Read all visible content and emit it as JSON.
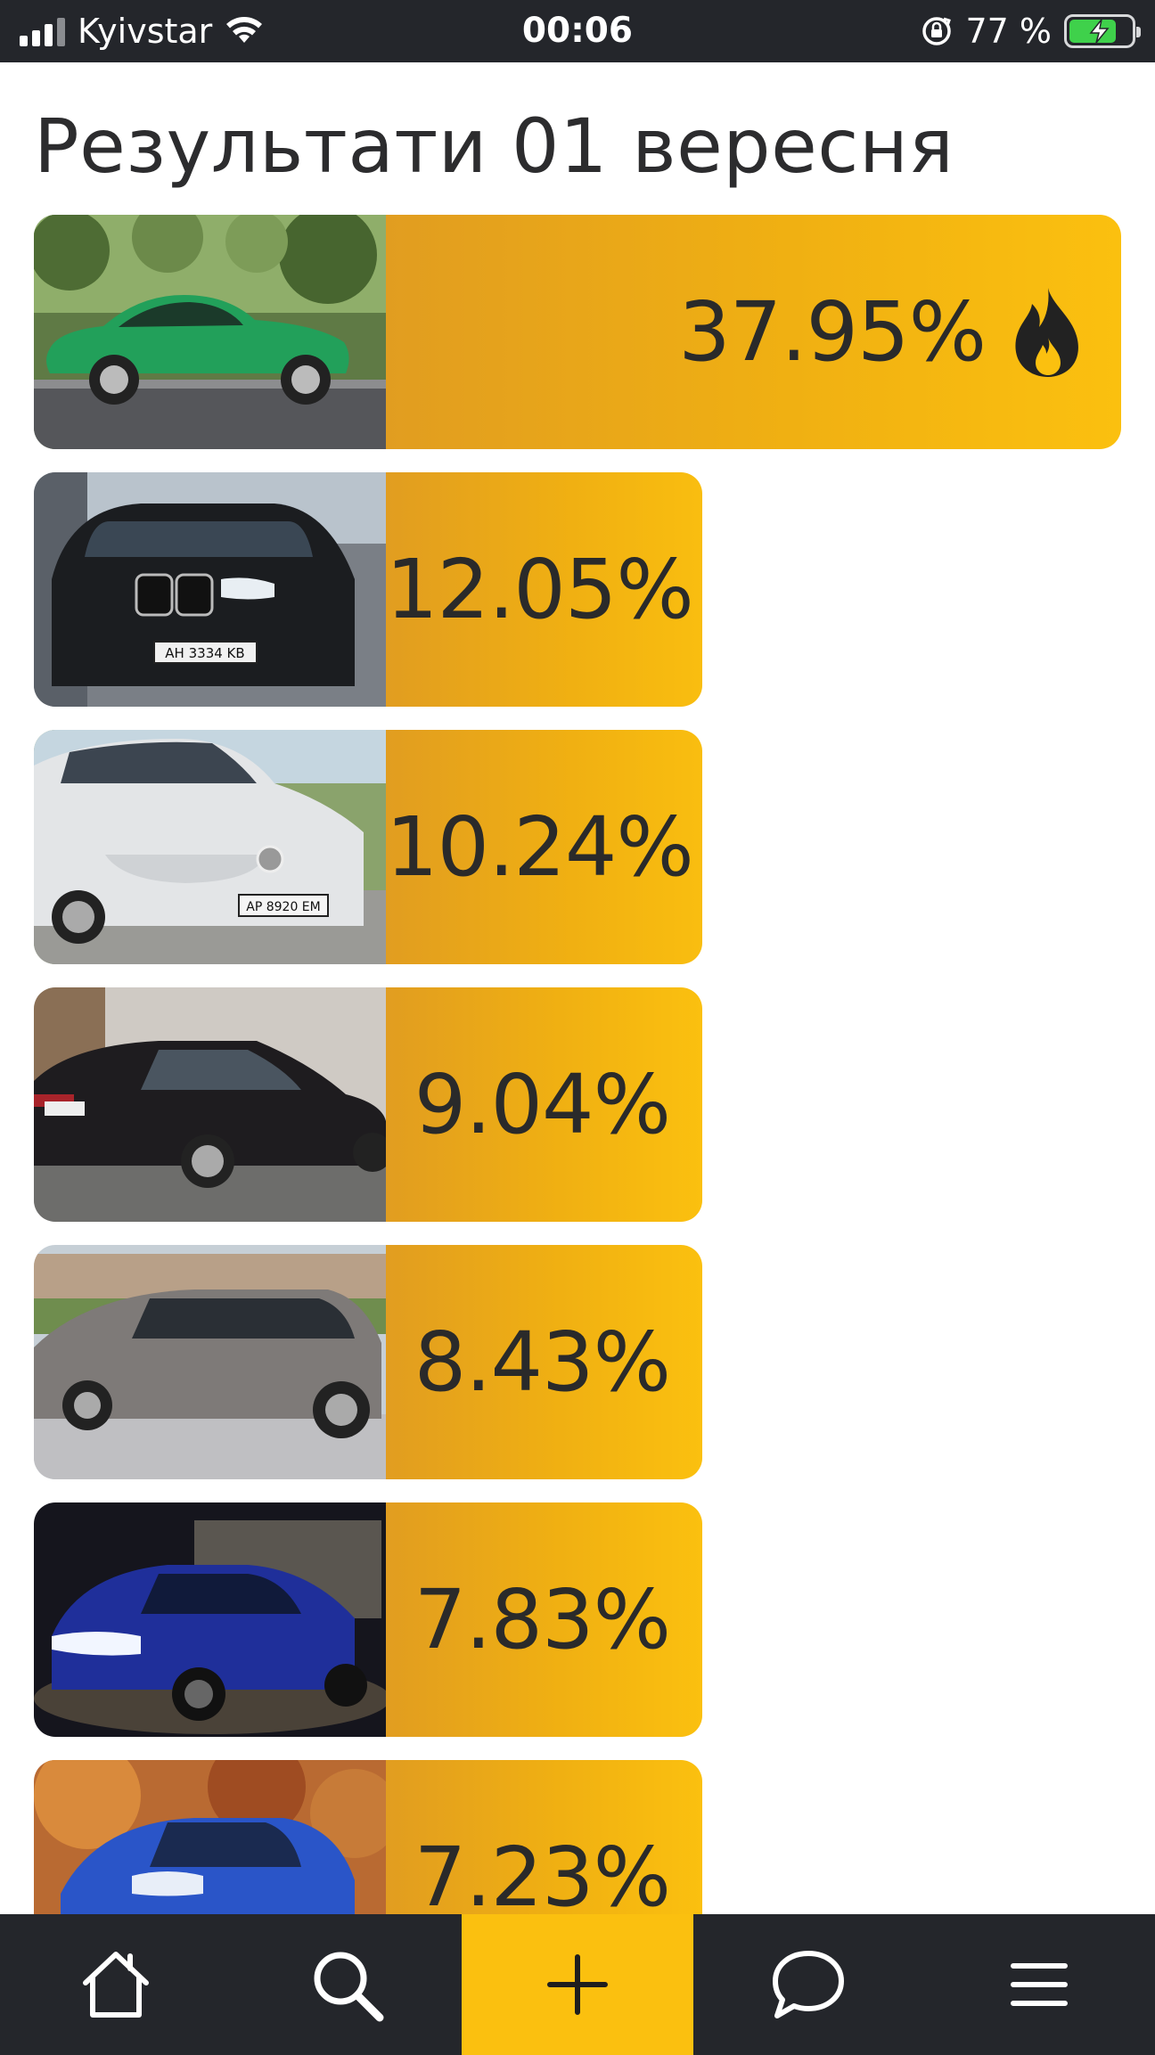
{
  "status_bar": {
    "carrier": "Kyivstar",
    "time": "00:06",
    "battery_percent": "77 %",
    "battery_level": 0.77,
    "signal_icon": "cellular-signal-icon",
    "wifi_icon": "wifi-icon",
    "rotation_lock_icon": "rotation-lock-icon",
    "battery_icon": "battery-charging-icon"
  },
  "page": {
    "title": "Результати 01 вересня"
  },
  "colors": {
    "accent": "#fbc00f",
    "accent_dark": "#e19d20",
    "bar_dark": "#24262b",
    "text": "#2c2c2e"
  },
  "results": [
    {
      "percent": "37.95%",
      "value": 37.95,
      "leader": true,
      "car": "green convertible"
    },
    {
      "percent": "12.05%",
      "value": 12.05,
      "car": "black SUV",
      "plate": "AH 3334 KB"
    },
    {
      "percent": "10.24%",
      "value": 10.24,
      "car": "white sedan",
      "plate": "AP 8920 EM"
    },
    {
      "percent": "9.04%",
      "value": 9.04,
      "car": "black sedan"
    },
    {
      "percent": "8.43%",
      "value": 8.43,
      "car": "grey wagon"
    },
    {
      "percent": "7.83%",
      "value": 7.83,
      "car": "blue crossover"
    },
    {
      "percent": "7.23%",
      "value": 7.23,
      "car": "blue hatchback"
    }
  ],
  "nav": [
    {
      "name": "home",
      "icon": "home-icon"
    },
    {
      "name": "search",
      "icon": "search-icon"
    },
    {
      "name": "add",
      "icon": "plus-icon"
    },
    {
      "name": "messages",
      "icon": "chat-bubble-icon"
    },
    {
      "name": "menu",
      "icon": "hamburger-menu-icon"
    }
  ]
}
